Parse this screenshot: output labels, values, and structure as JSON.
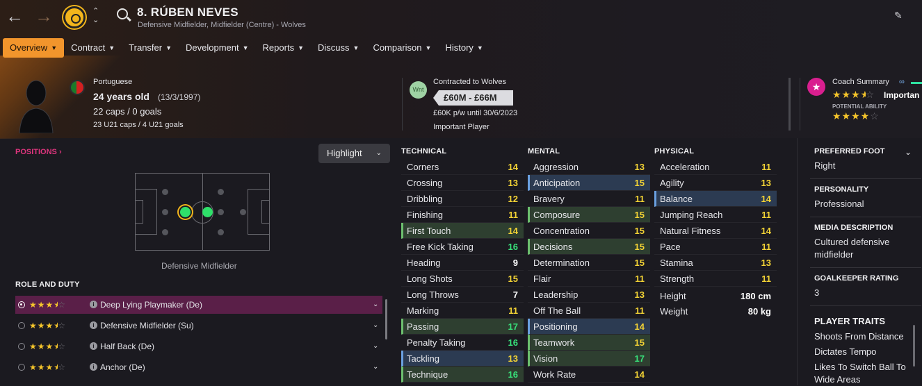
{
  "player": {
    "name": "8. RÚBEN NEVES",
    "subtitle": "Defensive Midfielder, Midfielder (Centre) - Wolves"
  },
  "tabs": [
    {
      "label": "Overview",
      "active": true
    },
    {
      "label": "Contract"
    },
    {
      "label": "Transfer"
    },
    {
      "label": "Development"
    },
    {
      "label": "Reports"
    },
    {
      "label": "Discuss"
    },
    {
      "label": "Comparison"
    },
    {
      "label": "History"
    }
  ],
  "bio": {
    "nationality": "Portuguese",
    "age": "24 years old",
    "dob": "(13/3/1997)",
    "caps": "22 caps / 0 goals",
    "u21": "23 U21 caps / 4 U21 goals"
  },
  "contract": {
    "club_badge": "Wnt",
    "status": "Contracted to Wolves",
    "value": "£60M - £66M",
    "wage": "£60K p/w until 30/6/2023",
    "role": "Important Player"
  },
  "coach": {
    "title": "Coach Summary",
    "importance": "Importan",
    "potential_label": "POTENTIAL ABILITY",
    "current_stars": 3.5,
    "potential_stars": 4
  },
  "positions": {
    "title": "POSITIONS",
    "highlight": "Highlight",
    "position_label": "Defensive Midfielder"
  },
  "roles": {
    "title": "ROLE AND DUTY",
    "items": [
      {
        "name": "Deep Lying Playmaker (De)",
        "stars": 3.5,
        "selected": true
      },
      {
        "name": "Defensive Midfielder (Su)",
        "stars": 3.5
      },
      {
        "name": "Half Back (De)",
        "stars": 3.5
      },
      {
        "name": "Anchor (De)",
        "stars": 3.5
      }
    ]
  },
  "technical": {
    "title": "TECHNICAL",
    "items": [
      {
        "name": "Corners",
        "value": "14"
      },
      {
        "name": "Crossing",
        "value": "13"
      },
      {
        "name": "Dribbling",
        "value": "12"
      },
      {
        "name": "Finishing",
        "value": "11"
      },
      {
        "name": "First Touch",
        "value": "14",
        "hl": "g"
      },
      {
        "name": "Free Kick Taking",
        "value": "16"
      },
      {
        "name": "Heading",
        "value": "9"
      },
      {
        "name": "Long Shots",
        "value": "15"
      },
      {
        "name": "Long Throws",
        "value": "7"
      },
      {
        "name": "Marking",
        "value": "11"
      },
      {
        "name": "Passing",
        "value": "17",
        "hl": "g"
      },
      {
        "name": "Penalty Taking",
        "value": "16"
      },
      {
        "name": "Tackling",
        "value": "13",
        "hl": "b"
      },
      {
        "name": "Technique",
        "value": "16",
        "hl": "g"
      }
    ]
  },
  "mental": {
    "title": "MENTAL",
    "items": [
      {
        "name": "Aggression",
        "value": "13"
      },
      {
        "name": "Anticipation",
        "value": "15",
        "hl": "b"
      },
      {
        "name": "Bravery",
        "value": "11"
      },
      {
        "name": "Composure",
        "value": "15",
        "hl": "g"
      },
      {
        "name": "Concentration",
        "value": "15"
      },
      {
        "name": "Decisions",
        "value": "15",
        "hl": "g"
      },
      {
        "name": "Determination",
        "value": "15"
      },
      {
        "name": "Flair",
        "value": "11"
      },
      {
        "name": "Leadership",
        "value": "13"
      },
      {
        "name": "Off The Ball",
        "value": "11"
      },
      {
        "name": "Positioning",
        "value": "14",
        "hl": "b"
      },
      {
        "name": "Teamwork",
        "value": "15",
        "hl": "g"
      },
      {
        "name": "Vision",
        "value": "17",
        "hl": "g"
      },
      {
        "name": "Work Rate",
        "value": "14"
      }
    ]
  },
  "physical": {
    "title": "PHYSICAL",
    "items": [
      {
        "name": "Acceleration",
        "value": "11"
      },
      {
        "name": "Agility",
        "value": "13"
      },
      {
        "name": "Balance",
        "value": "14",
        "hl": "b"
      },
      {
        "name": "Jumping Reach",
        "value": "11"
      },
      {
        "name": "Natural Fitness",
        "value": "14"
      },
      {
        "name": "Pace",
        "value": "11"
      },
      {
        "name": "Stamina",
        "value": "13"
      },
      {
        "name": "Strength",
        "value": "11"
      }
    ],
    "height_label": "Height",
    "height": "180 cm",
    "weight_label": "Weight",
    "weight": "80 kg"
  },
  "side": {
    "foot_label": "PREFERRED FOOT",
    "foot": "Right",
    "personality_label": "PERSONALITY",
    "personality": "Professional",
    "media_label": "MEDIA DESCRIPTION",
    "media": "Cultured defensive midfielder",
    "gk_label": "GOALKEEPER RATING",
    "gk": "3",
    "traits_label": "PLAYER TRAITS",
    "traits": [
      "Shoots From Distance",
      "Dictates Tempo",
      "Likes To Switch Ball To Wide Areas"
    ]
  },
  "colors": {
    "accent": "#f2952c",
    "green": "#38e07a",
    "yellow": "#f2d235",
    "pink": "#e0357e"
  }
}
